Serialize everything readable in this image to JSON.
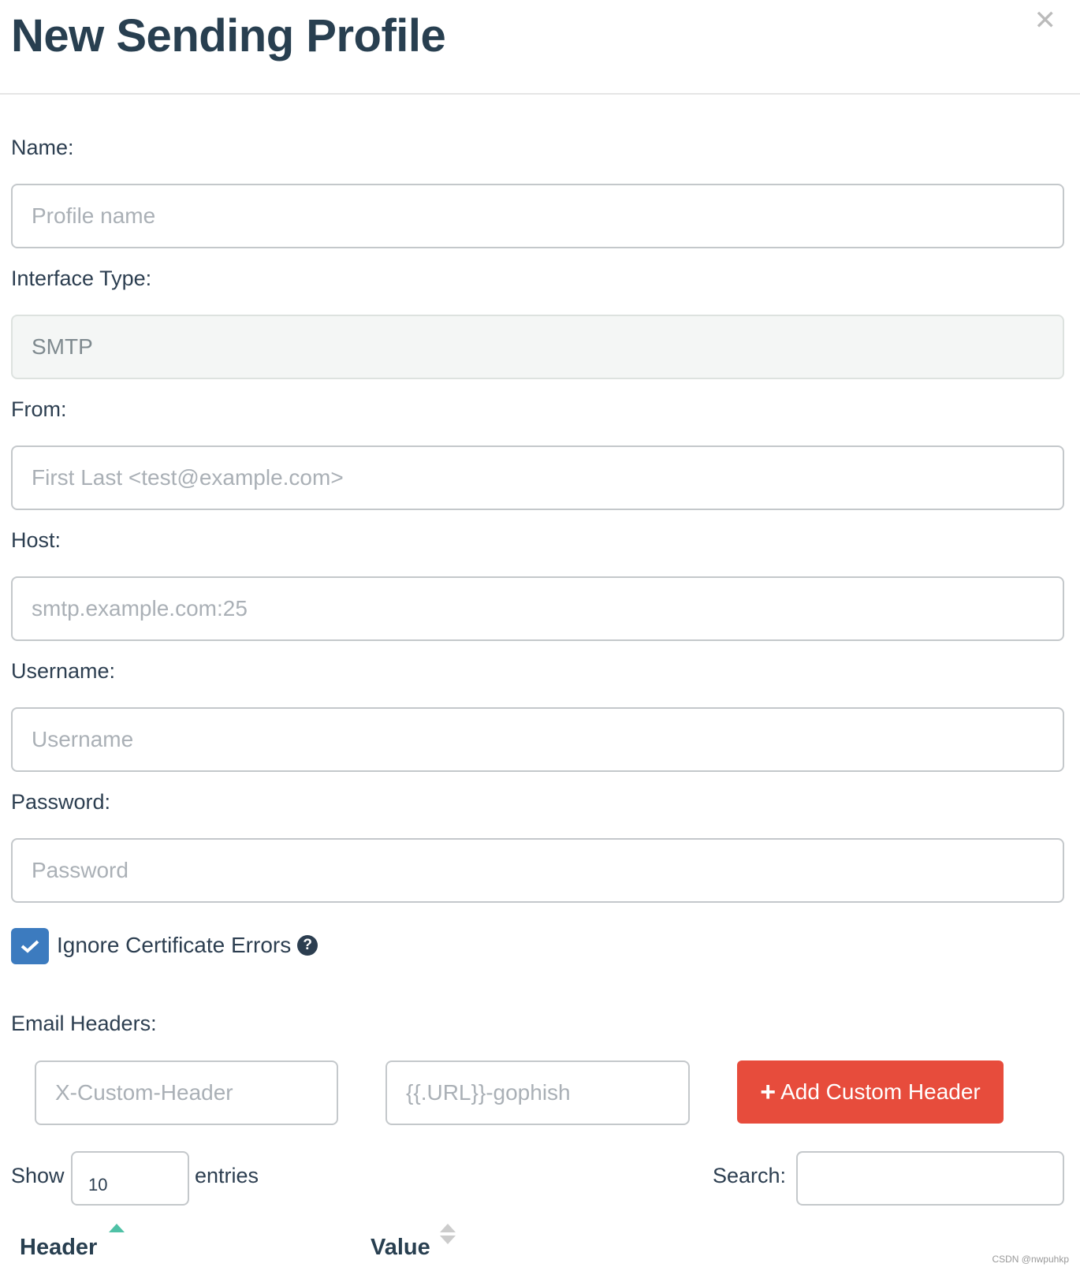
{
  "modal": {
    "title": "New Sending Profile",
    "close_icon": "close-icon"
  },
  "form": {
    "name": {
      "label": "Name:",
      "placeholder": "Profile name"
    },
    "interface": {
      "label": "Interface Type:",
      "value": "SMTP"
    },
    "from": {
      "label": "From:",
      "placeholder": "First Last <test@example.com>"
    },
    "host": {
      "label": "Host:",
      "placeholder": "smtp.example.com:25"
    },
    "username": {
      "label": "Username:",
      "placeholder": "Username"
    },
    "password": {
      "label": "Password:",
      "placeholder": "Password"
    },
    "ignore_cert": {
      "label": "Ignore Certificate Errors",
      "checked": true,
      "help": "?"
    }
  },
  "headers": {
    "label": "Email Headers:",
    "header_placeholder": "X-Custom-Header",
    "value_placeholder": "{{.URL}}-gophish",
    "add_button": "Add Custom Header",
    "add_icon": "+"
  },
  "table": {
    "show_label": "Show",
    "entries_value": "10",
    "entries_label": "entries",
    "search_label": "Search:",
    "columns": [
      "Header",
      "Value"
    ],
    "sort_active_color": "#4fc1a6"
  },
  "colors": {
    "accent": "#3c7bbf",
    "danger": "#e74c3c"
  },
  "watermark": "CSDN @nwpuhkp"
}
